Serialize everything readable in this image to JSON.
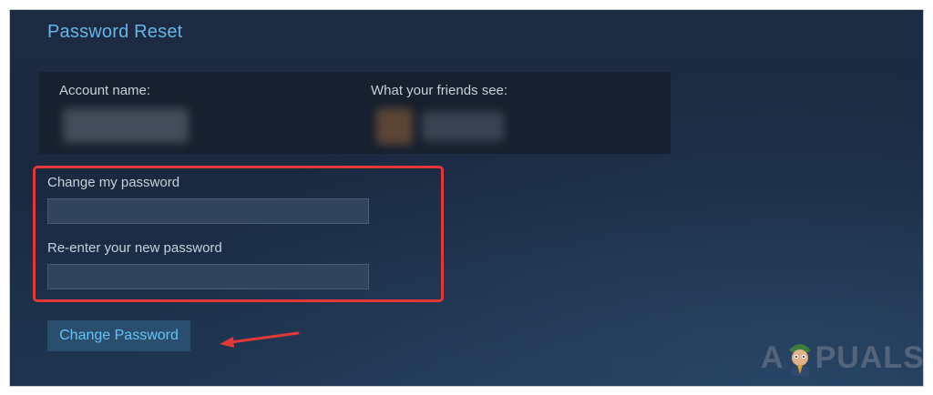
{
  "title": "Password Reset",
  "account": {
    "name_label": "Account name:",
    "friends_label": "What your friends see:"
  },
  "form": {
    "new_password_label": "Change my password",
    "new_password_value": "",
    "confirm_password_label": "Re-enter your new password",
    "confirm_password_value": "",
    "submit_label": "Change Password"
  },
  "watermark": {
    "left": "A",
    "right": "PUALS"
  },
  "colors": {
    "accent_title": "#66b4e8",
    "button_bg": "#2a4f6e",
    "button_text": "#67c1f5",
    "highlight": "#e23838"
  }
}
